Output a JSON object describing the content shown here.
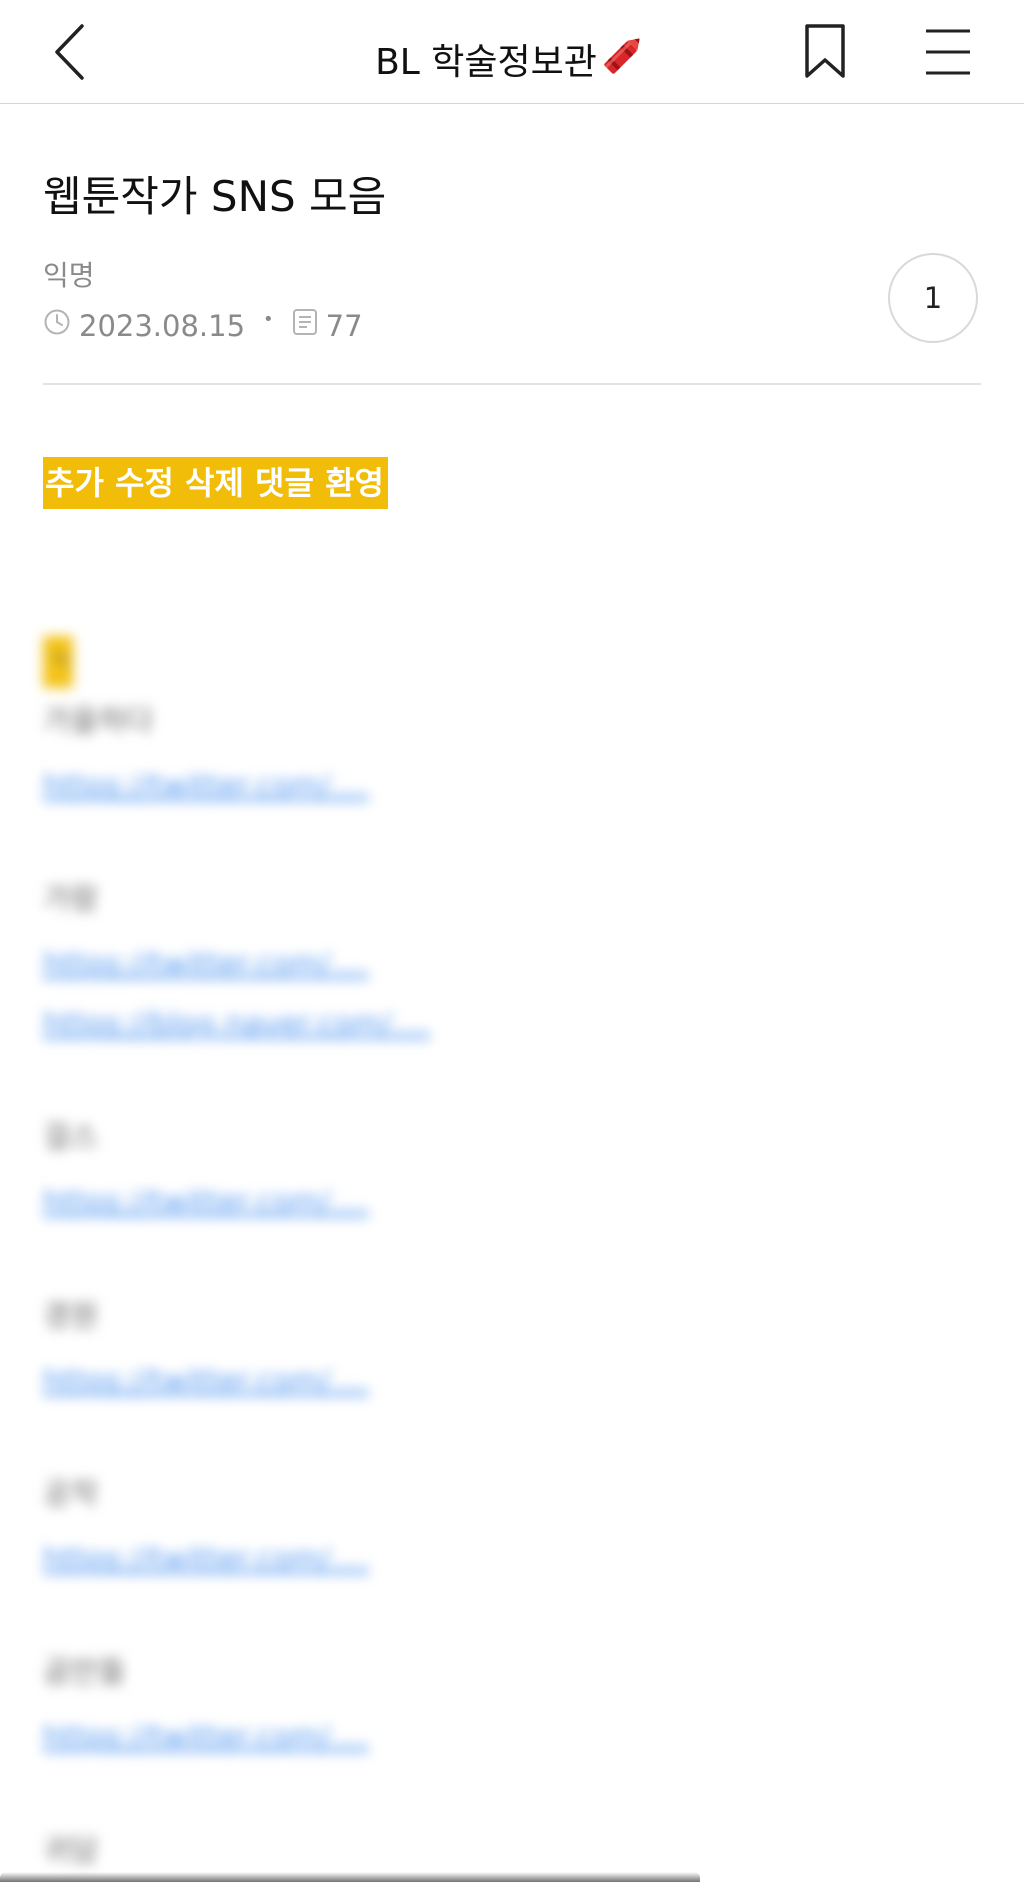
{
  "header": {
    "title": "BL 학술정보관",
    "title_emoji_icon": "crayon-icon",
    "back_icon": "chevron-left-icon",
    "bookmark_icon": "bookmark-icon",
    "menu_icon": "hamburger-menu-icon"
  },
  "post": {
    "title": "웹툰작가 SNS 모음",
    "author": "익명",
    "date": "2023.08.15",
    "views": "77",
    "comment_count": "1"
  },
  "notice": {
    "text": "추가 수정 삭제 댓글 환영",
    "highlight_color": "#f2bd08"
  },
  "section": {
    "initial": "ㄱ"
  },
  "entries": [
    {
      "name": "가을하다",
      "links": [
        "https://twitter.com/...."
      ]
    },
    {
      "name": "가람",
      "links": [
        "https://twitter.com/....",
        "https://blog.naver.com/...."
      ]
    },
    {
      "name": "걸스",
      "links": [
        "https://twitter.com/...."
      ]
    },
    {
      "name": "경원",
      "links": [
        "https://twitter.com/...."
      ]
    },
    {
      "name": "공작",
      "links": [
        "https://twitter.com/...."
      ]
    },
    {
      "name": "곰만들",
      "links": [
        "https://twitter.com/...."
      ]
    },
    {
      "name": "귀담",
      "links": []
    }
  ],
  "colors": {
    "link": "#4f95f0",
    "meta_gray": "#8a8a8a",
    "divider": "#e2e2e2"
  }
}
